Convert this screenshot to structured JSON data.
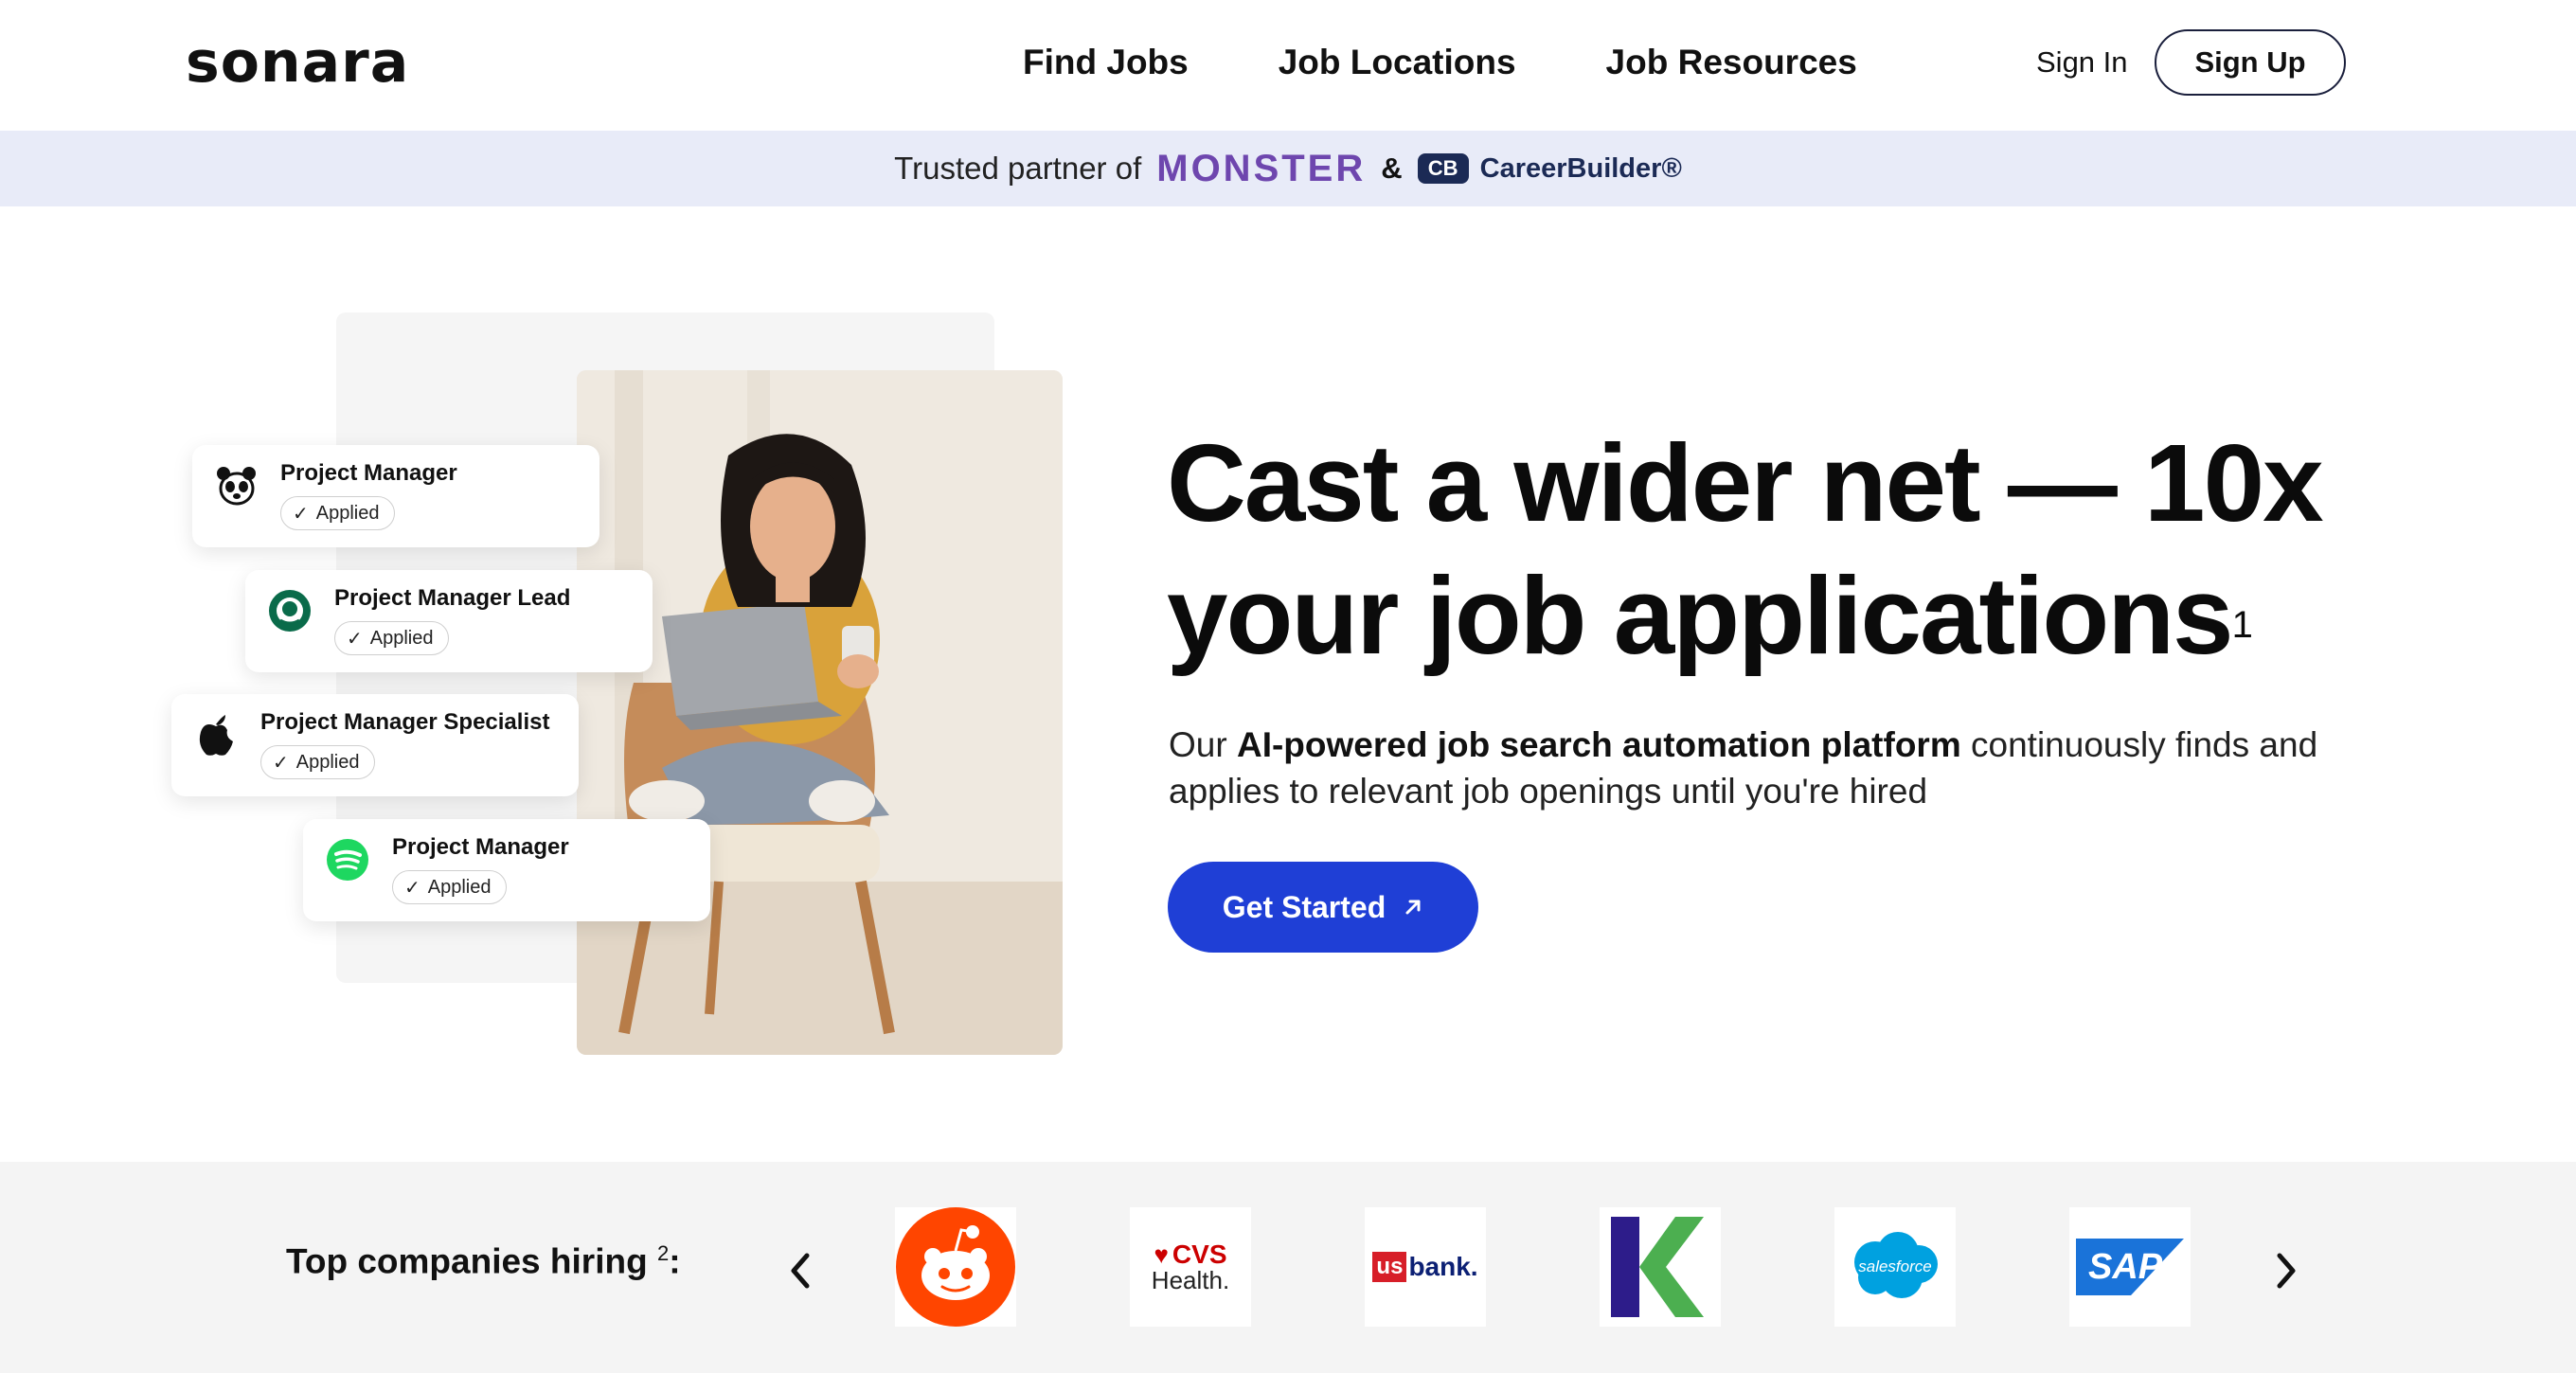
{
  "header": {
    "logo": "sonara",
    "nav": [
      "Find Jobs",
      "Job Locations",
      "Job Resources"
    ],
    "sign_in": "Sign In",
    "sign_up": "Sign Up"
  },
  "partner": {
    "text": "Trusted partner of",
    "monster": "MONSTER",
    "amp": "&",
    "cb_mark": "CB",
    "careerbuilder": "CareerBuilder®"
  },
  "cards": [
    {
      "title": "Project Manager",
      "status": "Applied",
      "icon": "wwf-panda-icon"
    },
    {
      "title": "Project Manager Lead",
      "status": "Applied",
      "icon": "starbucks-icon"
    },
    {
      "title": "Project Manager Specialist",
      "status": "Applied",
      "icon": "apple-icon"
    },
    {
      "title": "Project Manager",
      "status": "Applied",
      "icon": "spotify-icon"
    }
  ],
  "hero": {
    "headline_line1": "Cast a wider net — 10x",
    "headline_line2": "your job applications",
    "headline_sup": "1",
    "sub_prefix": "Our ",
    "sub_bold": "AI-powered job search automation platform",
    "sub_suffix": " continuously finds and applies to relevant job openings until you're hired",
    "cta": "Get Started"
  },
  "companies": {
    "label": "Top companies hiring",
    "label_sup": "2",
    "label_colon": ":",
    "logos": [
      {
        "name": "reddit",
        "icon": "reddit-icon"
      },
      {
        "name": "cvs",
        "text_top": "CVS",
        "text_bottom": "Health."
      },
      {
        "name": "usbank",
        "text_us": "us",
        "text_bank": "bank."
      },
      {
        "name": "k",
        "icon": "k-logo-icon"
      },
      {
        "name": "salesforce",
        "text": "salesforce"
      },
      {
        "name": "sap",
        "text": "SAP"
      }
    ]
  },
  "colors": {
    "accent": "#1f3fd6",
    "partner_bg": "#e8ebf8",
    "monster": "#6e46ae",
    "strip_bg": "#f4f4f4"
  }
}
